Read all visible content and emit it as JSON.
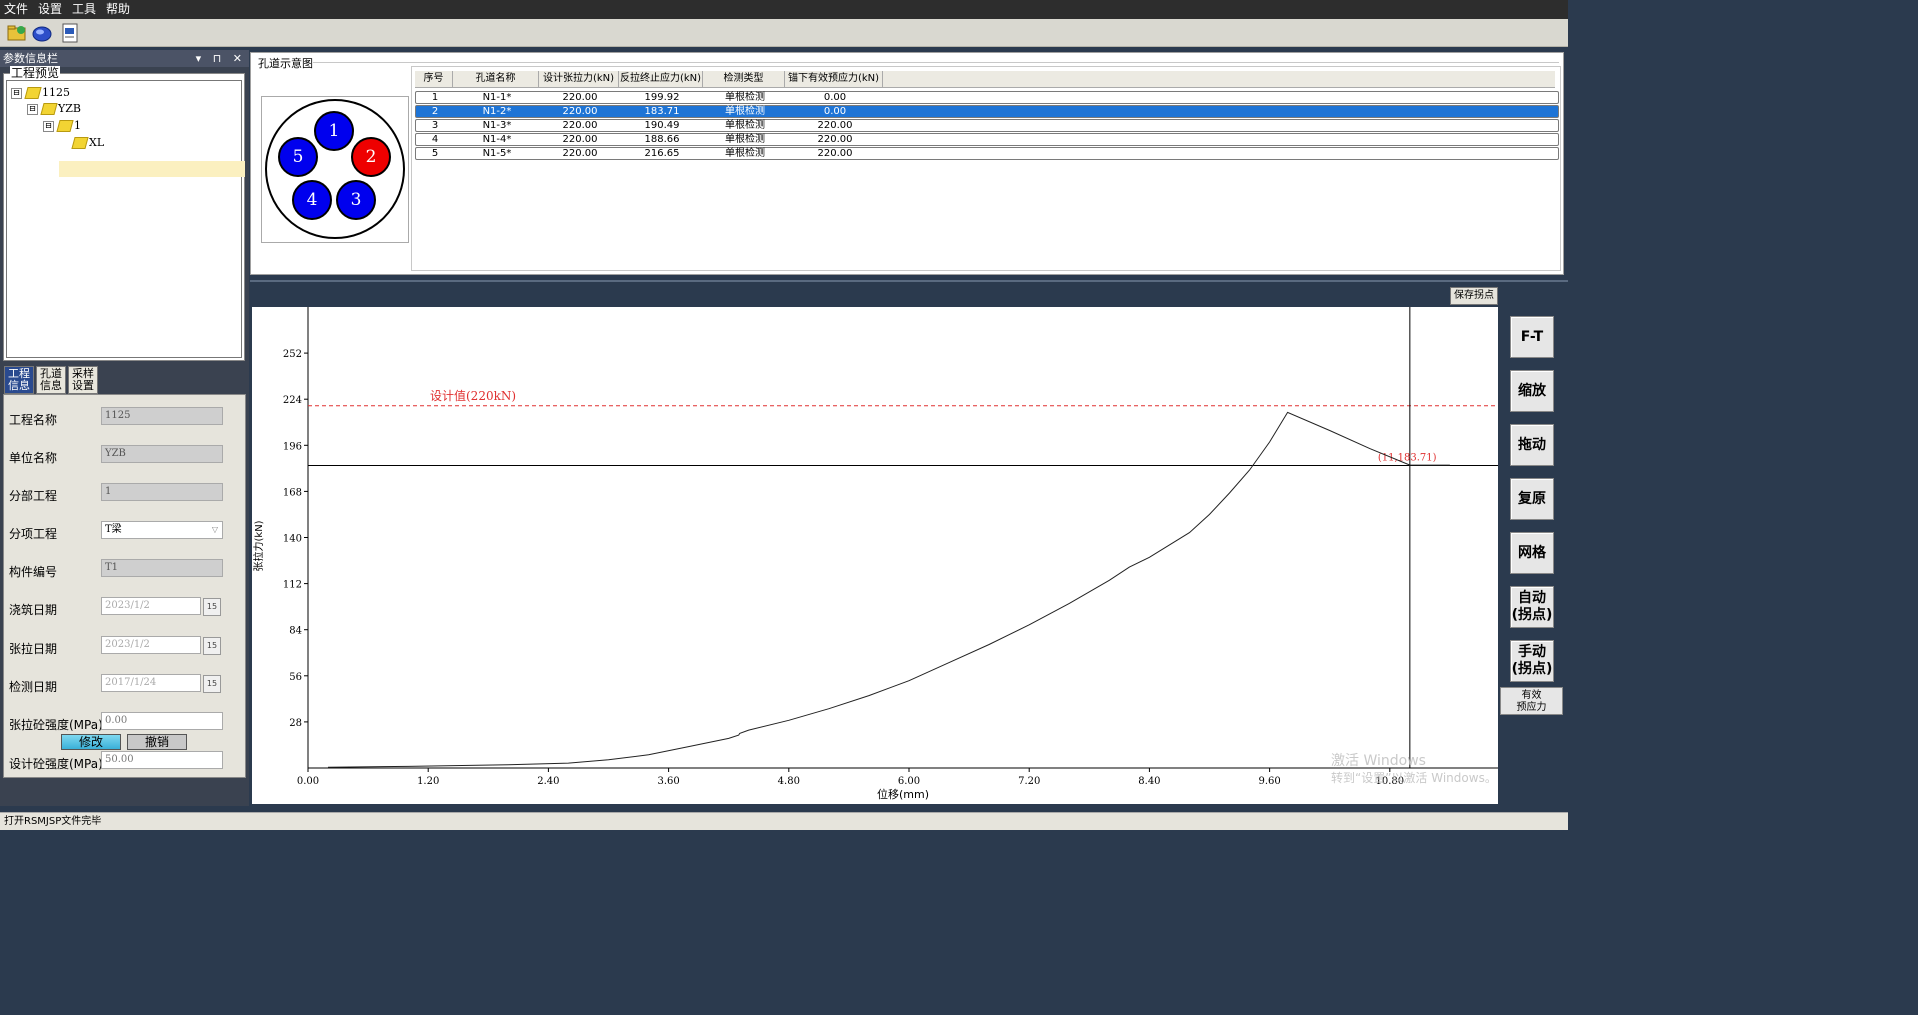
{
  "menu": [
    "文件",
    "设置",
    "工具",
    "帮助"
  ],
  "toolbar": {
    "icons": [
      "open-folder-icon",
      "disc-icon",
      "word-doc-icon"
    ]
  },
  "left_panel": {
    "title": "参数信息栏",
    "controls": "▾ ⊓ ✕",
    "tree_legend": "工程预览",
    "tree": [
      {
        "label": "1125",
        "toggle": "⊟"
      },
      {
        "label": "YZB",
        "toggle": "⊟"
      },
      {
        "label": "1",
        "toggle": "⊟"
      },
      {
        "label": "XL",
        "toggle": ""
      }
    ],
    "tabs": [
      "工程\n信息",
      "孔道\n信息",
      "采样\n设置"
    ],
    "form": [
      {
        "label": "工程名称",
        "value": "1125"
      },
      {
        "label": "单位名称",
        "value": "YZB"
      },
      {
        "label": "分部工程",
        "value": "1"
      },
      {
        "label": "分项工程",
        "value": "T梁"
      },
      {
        "label": "构件编号",
        "value": "T1"
      },
      {
        "label": "浇筑日期",
        "value": "2023/1/2"
      },
      {
        "label": "张拉日期",
        "value": "2023/1/2"
      },
      {
        "label": "检测日期",
        "value": "2017/1/24"
      },
      {
        "label": "张拉砼强度(MPa)",
        "value": "0.00"
      },
      {
        "label": "设计砼强度(MPa)",
        "value": "50.00"
      }
    ],
    "cal_label": "15",
    "modify_label": "修改",
    "cancel_label": "撤销"
  },
  "hole_panel": {
    "title": "孔道示意图",
    "holes": [
      {
        "num": "1",
        "color": "#0000ee"
      },
      {
        "num": "2",
        "color": "#ee0000"
      },
      {
        "num": "3",
        "color": "#0000ee"
      },
      {
        "num": "4",
        "color": "#0000ee"
      },
      {
        "num": "5",
        "color": "#0000ee"
      }
    ]
  },
  "table": {
    "headers": [
      "序号",
      "孔道名称",
      "设计张拉力(kN)",
      "反拉终止应力(kN)",
      "检测类型",
      "锚下有效预应力(kN)"
    ],
    "rows": [
      [
        "1",
        "N1-1*",
        "220.00",
        "199.92",
        "单根检测",
        "0.00"
      ],
      [
        "2",
        "N1-2*",
        "220.00",
        "183.71",
        "单根检测",
        "0.00"
      ],
      [
        "3",
        "N1-3*",
        "220.00",
        "190.49",
        "单根检测",
        "220.00"
      ],
      [
        "4",
        "N1-4*",
        "220.00",
        "188.66",
        "单根检测",
        "220.00"
      ],
      [
        "5",
        "N1-5*",
        "220.00",
        "216.65",
        "单根检测",
        "220.00"
      ]
    ],
    "selected_row": 1
  },
  "chart": {
    "save_button": "保存拐点",
    "design_label": "设计值(220kN)",
    "cursor_label": "(11,183.71)",
    "colors": {
      "curve": "#222222",
      "design_line": "#e03030",
      "cursor_label": "#e03030"
    }
  },
  "chart_data": {
    "type": "line",
    "xlabel": "位移(mm)",
    "ylabel": "张拉力(kN)",
    "xlim": [
      0,
      11.88
    ],
    "ylim": [
      0,
      280
    ],
    "x_ticks": [
      0,
      1.2,
      2.4,
      3.6,
      4.8,
      6.0,
      7.2,
      8.4,
      9.6,
      10.8
    ],
    "x_tick_labels": [
      "0.00",
      "1.20",
      "2.40",
      "3.60",
      "4.80",
      "6.00",
      "7.20",
      "8.40",
      "9.60",
      "10.80"
    ],
    "y_ticks": [
      28,
      56,
      84,
      112,
      140,
      168,
      196,
      224,
      252
    ],
    "y_tick_labels": [
      "28",
      "56",
      "84",
      "112",
      "140",
      "168",
      "196",
      "224",
      "252"
    ],
    "design_value": 220,
    "cursor": {
      "x": 11,
      "y": 183.71
    },
    "series": [
      {
        "x": [
          0.2,
          1.0,
          2.0,
          2.6,
          3.0,
          3.4,
          3.8,
          4.2,
          4.3,
          4.31,
          4.4,
          4.8,
          5.2,
          5.6,
          6.0,
          6.4,
          6.8,
          7.2,
          7.6,
          8.0,
          8.2,
          8.4,
          8.8,
          9.0,
          9.2,
          9.4,
          9.6,
          9.78,
          10.2,
          10.6,
          11.0,
          11.4
        ],
        "y": [
          0.5,
          1,
          2,
          3,
          5,
          8,
          13,
          18,
          20,
          21,
          23,
          29,
          36,
          44,
          53,
          64,
          75,
          87,
          100,
          114,
          122,
          128,
          143,
          154,
          167,
          181,
          198,
          216,
          205,
          194,
          184,
          184
        ]
      }
    ]
  },
  "side_buttons": [
    "F-T",
    "缩放",
    "拖动",
    "复原",
    "网格",
    "自动\n(拐点)",
    "手动\n(拐点)"
  ],
  "effective_button": "有效\n预应力",
  "status": "打开RSMJSP文件完毕",
  "watermark": {
    "line1": "激活 Windows",
    "line2": "转到“设置”以激活 Windows。"
  }
}
